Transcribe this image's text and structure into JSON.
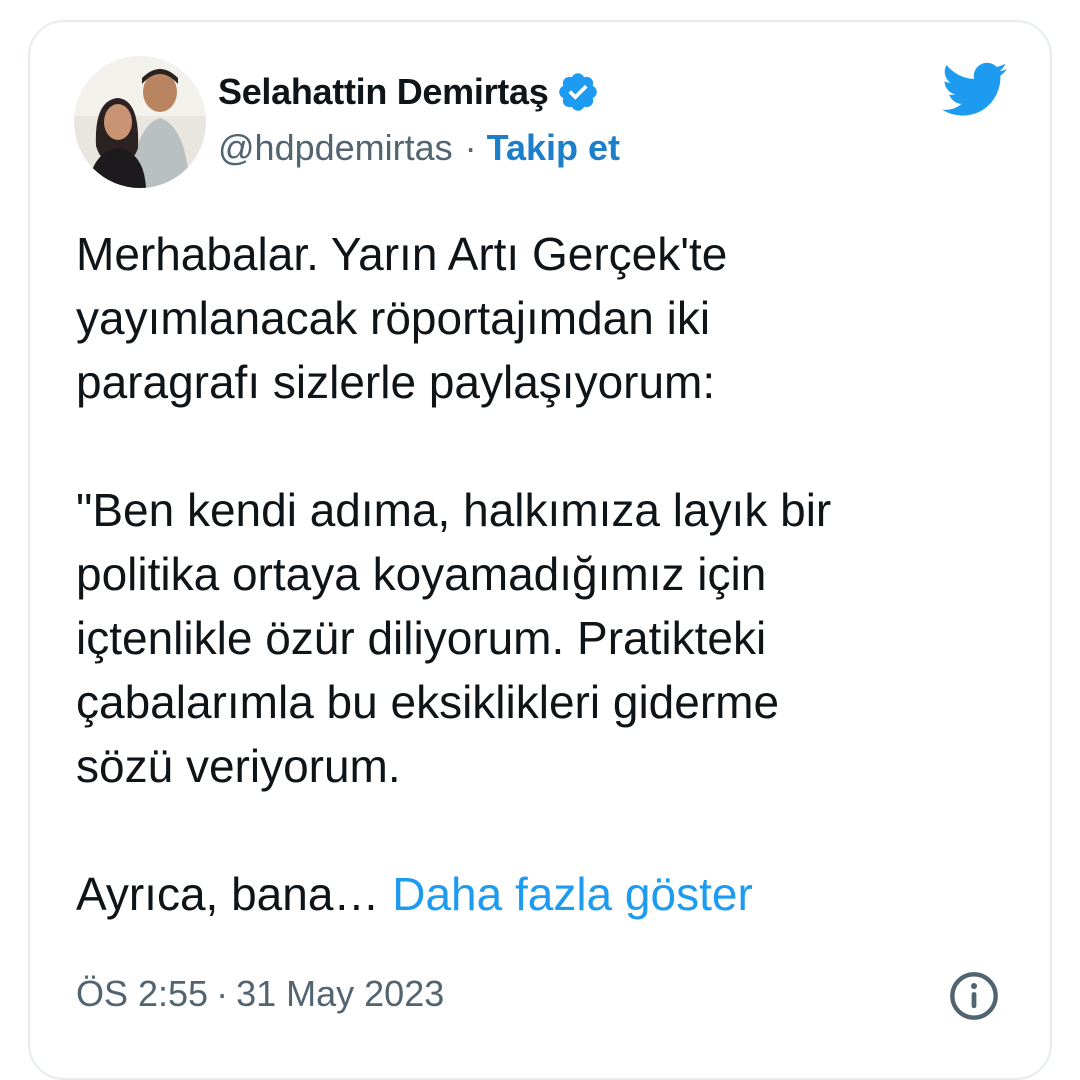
{
  "tweet": {
    "author": {
      "name": "Selahattin Demirtaş",
      "handle": "@hdpdemirtas",
      "separator": "·",
      "follow_label": "Takip et"
    },
    "icons": {
      "verified": "verified-badge-icon",
      "brand": "twitter-bird-icon",
      "info": "info-icon"
    },
    "body": {
      "paragraph1": [
        "Merhabalar. Yarın Artı Gerçek'te",
        "yayımlanacak röportajımdan iki",
        "paragrafı sizlerle paylaşıyorum:"
      ],
      "paragraph2": [
        "\"Ben kendi adıma, halkımıza layık bir",
        "politika ortaya koyamadığımız için",
        "içtenlikle özür diliyorum. Pratikteki",
        "çabalarımla bu eksiklikleri giderme",
        "sözü veriyorum."
      ],
      "truncated": "Ayrıca, bana…",
      "show_more": "Daha fazla göster"
    },
    "footer": {
      "time": "ÖS 2:55",
      "separator": "·",
      "date": "31 May 2023"
    }
  },
  "colors": {
    "brand_blue": "#1d9bf0",
    "link_blue": "#1d7fc9",
    "text": "#0f1419",
    "muted": "#536471",
    "border": "#e6ecf0"
  }
}
